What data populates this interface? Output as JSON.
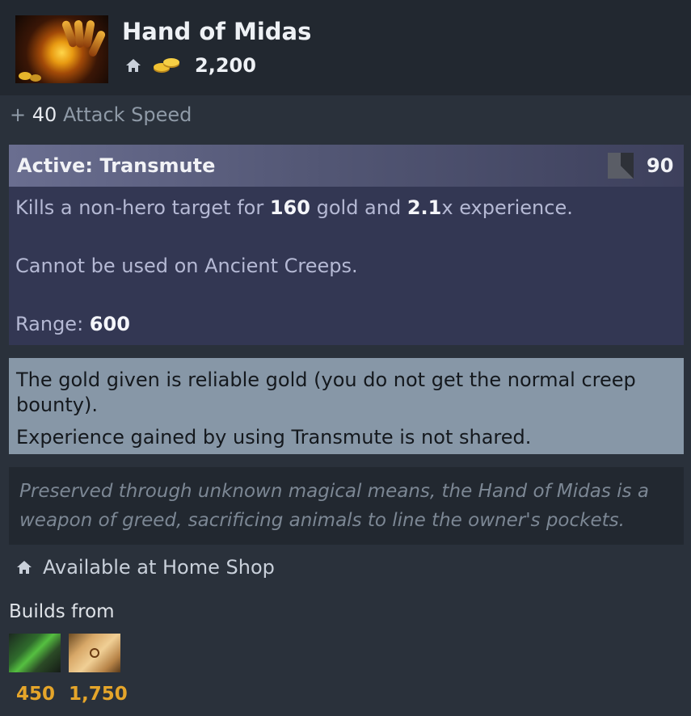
{
  "item": {
    "name": "Hand of Midas",
    "cost": "2,200",
    "icon": "hand-of-midas-icon"
  },
  "bonus": {
    "prefix": "+",
    "value": "40",
    "stat": "Attack Speed"
  },
  "active": {
    "title": "Active: Transmute",
    "cooldown": "90",
    "desc_1_a": "Kills a non-hero target for",
    "desc_1_b": "160",
    "desc_1_c": "gold and",
    "desc_1_d": "2.1",
    "desc_1_e": "x experience.",
    "desc_2": "Cannot be used on Ancient Creeps.",
    "range_label": "Range:",
    "range_value": "600"
  },
  "notes": {
    "line_1": "The gold given is reliable gold (you do not get the normal creep",
    "line_2": "bounty).",
    "line_3": "Experience gained by using Transmute is not shared."
  },
  "lore": {
    "line_1": "Preserved through unknown magical means, the Hand of Midas is a",
    "line_2": "weapon of greed, sacrificing animals to line the owner's pockets."
  },
  "availability": "Available at Home Shop",
  "builds": {
    "label": "Builds from",
    "components": [
      {
        "icon": "gloves-of-haste-icon",
        "price": "450"
      },
      {
        "icon": "recipe-scroll-icon",
        "price": "1,750"
      }
    ]
  },
  "colors": {
    "background": "#2a313b",
    "gold_price": "#e5a52a",
    "active_panel": "#333753",
    "note_panel": "#8797a7"
  }
}
